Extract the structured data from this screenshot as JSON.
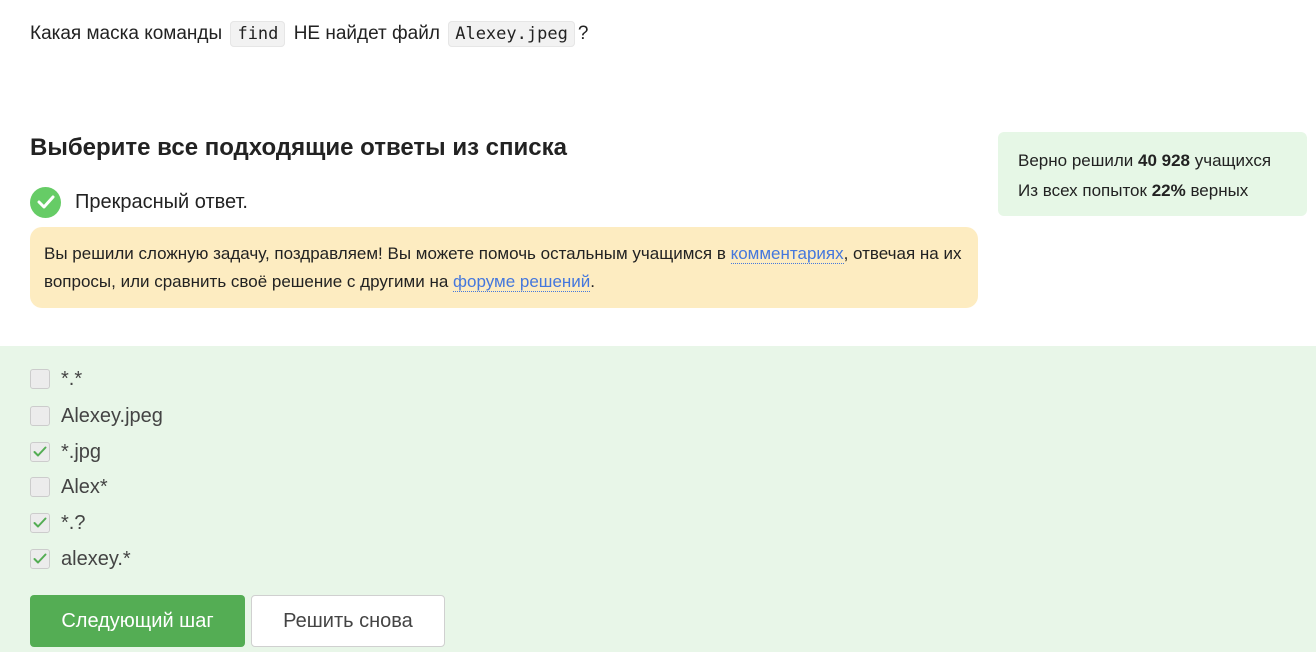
{
  "question": {
    "prefix": "Какая маска команды",
    "code1": "find",
    "middle": "НЕ найдет файл",
    "code2": "Alexey.jpeg",
    "suffix": "?"
  },
  "heading": "Выберите все подходящие ответы из списка",
  "feedback": {
    "text": "Прекрасный ответ.",
    "icon": "check-circle-icon",
    "icon_color": "#66cc66"
  },
  "congrats": {
    "text1": "Вы решили сложную задачу, поздравляем! Вы можете помочь остальным учащимся в ",
    "link1": "комментариях",
    "text2": ", отвечая на их вопросы, или сравнить своё решение с другими на ",
    "link2": "форуме решений",
    "text3": "."
  },
  "stats": {
    "line1_prefix": "Верно решили ",
    "line1_value": "40 928",
    "line1_suffix": " учащихся",
    "line2_prefix": "Из всех попыток ",
    "line2_value": "22%",
    "line2_suffix": " верных"
  },
  "options": [
    {
      "label": "*.*",
      "checked": false
    },
    {
      "label": "Alexey.jpeg",
      "checked": false
    },
    {
      "label": "*.jpg",
      "checked": true
    },
    {
      "label": "Alex*",
      "checked": false
    },
    {
      "label": "*.?",
      "checked": true
    },
    {
      "label": "alexey.*",
      "checked": true
    }
  ],
  "buttons": {
    "next": "Следующий шаг",
    "retry": "Решить снова"
  },
  "colors": {
    "accent_green": "#54ad54",
    "success_bg": "#e8f6e8",
    "congrats_bg": "#fdecc1",
    "link": "#4477dd"
  }
}
